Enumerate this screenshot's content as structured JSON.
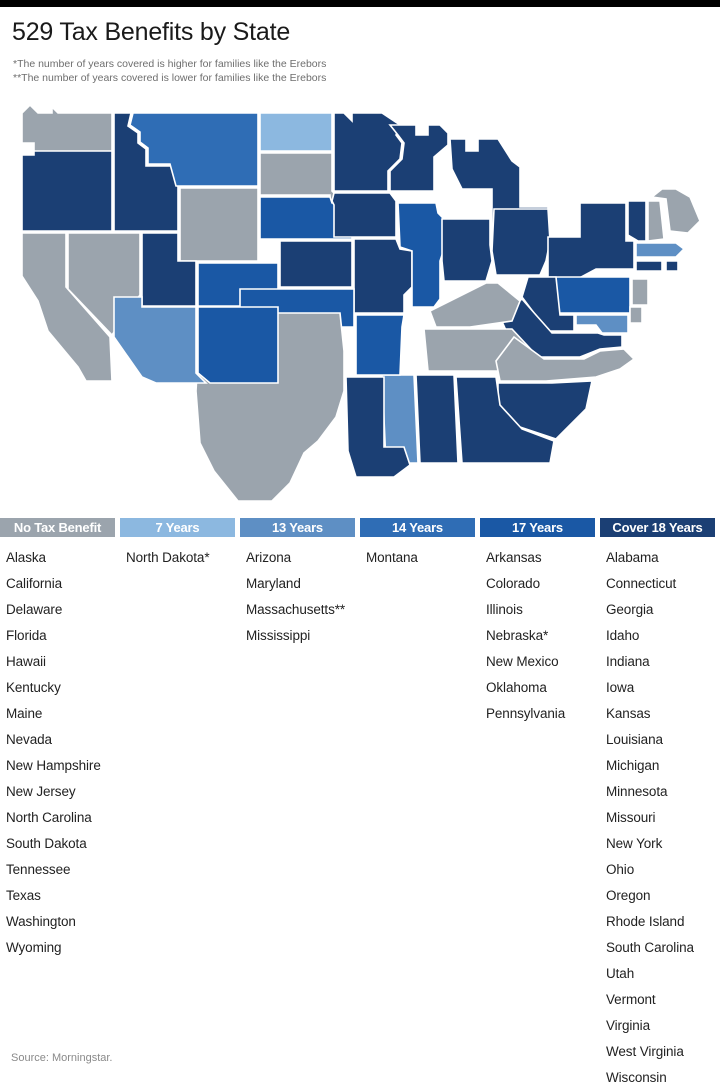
{
  "header": {
    "title": "529 Tax Benefits by State",
    "footnotes": [
      "*The number of years covered is higher for families like the Erebors",
      "**The number of years covered is lower for families like the Erebors"
    ]
  },
  "source": "Source: Morningstar.",
  "palette": {
    "no_benefit": "#9ba4ad",
    "years_7": "#8cb8e0",
    "years_13": "#5e8fc4",
    "years_14": "#2f6db5",
    "years_17": "#1a58a5",
    "years_18": "#1b3f74",
    "black_bar": "#000000",
    "title_color": "#1a1a1a",
    "footnote_color": "#6e6e6e",
    "source_color": "#8a8a8a",
    "state_border": "#ffffff"
  },
  "chart_data": {
    "type": "map",
    "title": "529 Tax Benefits by State",
    "legend_position": "below-map",
    "categories": [
      {
        "key": "no_benefit",
        "label": "No Tax Benefit",
        "color": "#9ba4ad",
        "count": 16
      },
      {
        "key": "years_7",
        "label": "7 Years",
        "color": "#8cb8e0",
        "count": 1
      },
      {
        "key": "years_13",
        "label": "13 Years",
        "color": "#5e8fc4",
        "count": 4
      },
      {
        "key": "years_14",
        "label": "14 Years",
        "color": "#2f6db5",
        "count": 1
      },
      {
        "key": "years_17",
        "label": "17 Years",
        "color": "#1a58a5",
        "count": 7
      },
      {
        "key": "years_18",
        "label": "Cover 18 Years",
        "color": "#1b3f74",
        "count": 21
      }
    ],
    "values": {
      "Alabama": "Cover 18 Years",
      "Alaska": "No Tax Benefit",
      "Arizona": "13 Years",
      "Arkansas": "17 Years",
      "California": "No Tax Benefit",
      "Colorado": "17 Years",
      "Connecticut": "Cover 18 Years",
      "Delaware": "No Tax Benefit",
      "Florida": "No Tax Benefit",
      "Georgia": "Cover 18 Years",
      "Hawaii": "No Tax Benefit",
      "Idaho": "Cover 18 Years",
      "Illinois": "17 Years",
      "Indiana": "Cover 18 Years",
      "Iowa": "Cover 18 Years",
      "Kansas": "Cover 18 Years",
      "Kentucky": "No Tax Benefit",
      "Louisiana": "Cover 18 Years",
      "Maine": "No Tax Benefit",
      "Maryland": "13 Years",
      "Massachusetts": "13 Years",
      "Michigan": "Cover 18 Years",
      "Minnesota": "Cover 18 Years",
      "Mississippi": "13 Years",
      "Missouri": "Cover 18 Years",
      "Montana": "14 Years",
      "Nebraska": "17 Years",
      "Nevada": "No Tax Benefit",
      "New Hampshire": "No Tax Benefit",
      "New Jersey": "No Tax Benefit",
      "New Mexico": "17 Years",
      "New York": "Cover 18 Years",
      "North Carolina": "No Tax Benefit",
      "North Dakota": "7 Years",
      "Ohio": "Cover 18 Years",
      "Oklahoma": "17 Years",
      "Oregon": "Cover 18 Years",
      "Pennsylvania": "17 Years",
      "Rhode Island": "Cover 18 Years",
      "South Carolina": "Cover 18 Years",
      "South Dakota": "No Tax Benefit",
      "Tennessee": "No Tax Benefit",
      "Texas": "No Tax Benefit",
      "Utah": "Cover 18 Years",
      "Vermont": "Cover 18 Years",
      "Virginia": "Cover 18 Years",
      "Washington": "No Tax Benefit",
      "West Virginia": "Cover 18 Years",
      "Wisconsin": "Cover 18 Years",
      "Wyoming": "No Tax Benefit"
    }
  },
  "legend": {
    "columns": [
      {
        "header": "No Tax Benefit",
        "color": "#9ba4ad",
        "states": [
          "Alaska",
          "California",
          "Delaware",
          "Florida",
          "Hawaii",
          "Kentucky",
          "Maine",
          "Nevada",
          "New Hampshire",
          "New Jersey",
          "North Carolina",
          "South Dakota",
          "Tennessee",
          "Texas",
          "Washington",
          "Wyoming"
        ]
      },
      {
        "header": "7 Years",
        "color": "#8cb8e0",
        "states": [
          "North Dakota*"
        ]
      },
      {
        "header": "13 Years",
        "color": "#5e8fc4",
        "states": [
          "Arizona",
          "Maryland",
          "Massachusetts**",
          "Mississippi"
        ]
      },
      {
        "header": "14 Years",
        "color": "#2f6db5",
        "states": [
          "Montana"
        ]
      },
      {
        "header": "17 Years",
        "color": "#1a58a5",
        "states": [
          "Arkansas",
          "Colorado",
          "Illinois",
          "Nebraska*",
          "New Mexico",
          "Oklahoma",
          "Pennsylvania"
        ]
      },
      {
        "header": "Cover 18 Years",
        "color": "#1b3f74",
        "states": [
          "Alabama",
          "Connecticut",
          "Georgia",
          "Idaho",
          "Indiana",
          "Iowa",
          "Kansas",
          "Louisiana",
          "Michigan",
          "Minnesota",
          "Missouri",
          "New York",
          "Ohio",
          "Oregon",
          "Rhode Island",
          "South Carolina",
          "Utah",
          "Vermont",
          "Virginia",
          "West Virginia",
          "Wisconsin"
        ]
      }
    ]
  }
}
